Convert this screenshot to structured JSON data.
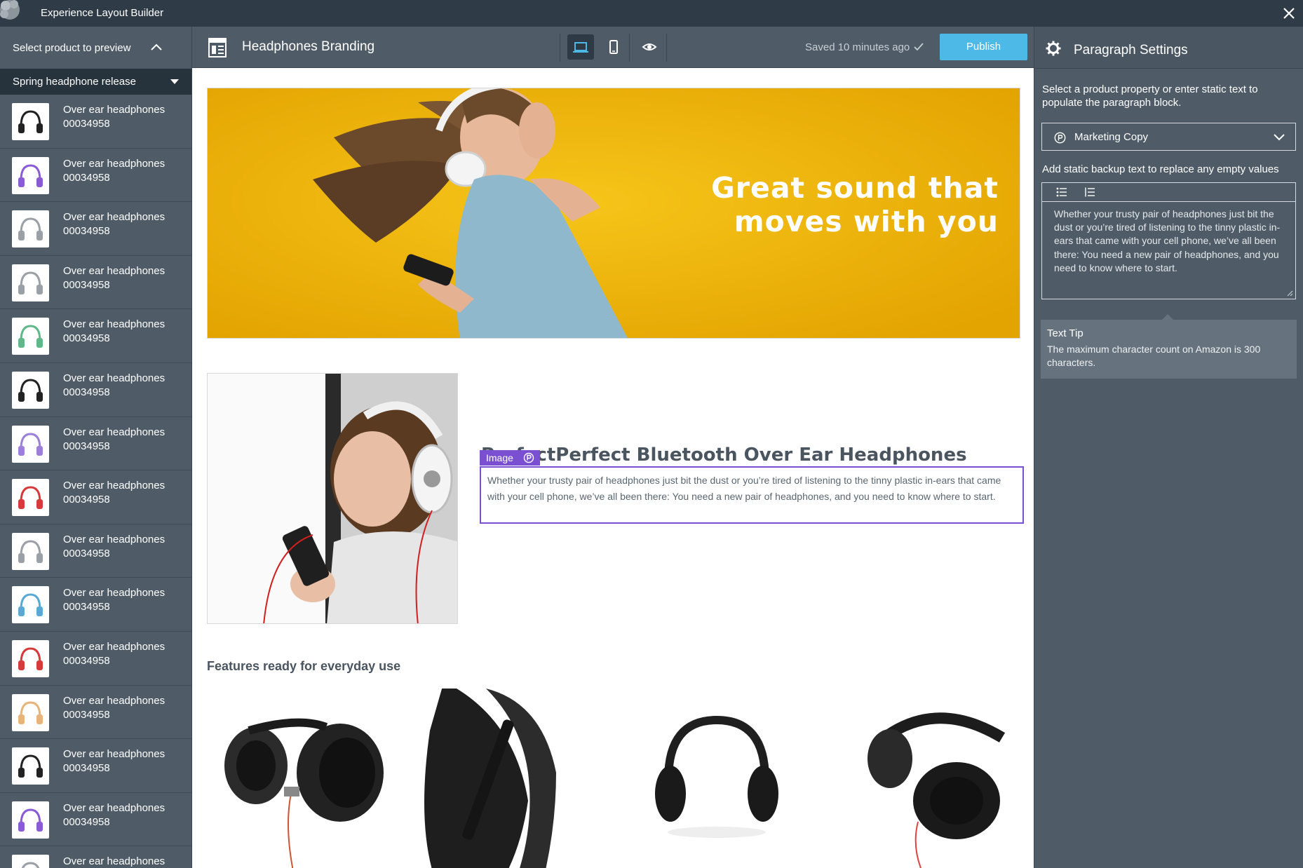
{
  "app": {
    "title": "Experience Layout Builder"
  },
  "sidebar": {
    "header": "Select product to preview",
    "campaign": "Spring headphone release",
    "products": [
      {
        "name": "Over ear headphones",
        "id": "00034958",
        "color": "#222222"
      },
      {
        "name": "Over ear headphones",
        "id": "00034958",
        "color": "#8a5bd6"
      },
      {
        "name": "Over ear headphones",
        "id": "00034958",
        "color": "#9aa0a6"
      },
      {
        "name": "Over ear headphones",
        "id": "00034958",
        "color": "#9aa0a6"
      },
      {
        "name": "Over ear headphones",
        "id": "00034958",
        "color": "#5fb88a"
      },
      {
        "name": "Over ear headphones",
        "id": "00034958",
        "color": "#222222"
      },
      {
        "name": "Over ear headphones",
        "id": "00034958",
        "color": "#9b7fd8"
      },
      {
        "name": "Over ear headphones",
        "id": "00034958",
        "color": "#d63a3a"
      },
      {
        "name": "Over ear headphones",
        "id": "00034958",
        "color": "#9aa0a6"
      },
      {
        "name": "Over ear headphones",
        "id": "00034958",
        "color": "#5aa8d6"
      },
      {
        "name": "Over ear headphones",
        "id": "00034958",
        "color": "#d63a3a"
      },
      {
        "name": "Over ear headphones",
        "id": "00034958",
        "color": "#e8b47a"
      },
      {
        "name": "Over ear headphones",
        "id": "00034958",
        "color": "#222222"
      },
      {
        "name": "Over ear headphones",
        "id": "00034958",
        "color": "#8a5bd6"
      },
      {
        "name": "Over ear headphones",
        "id": "",
        "color": "#9aa0a6"
      }
    ]
  },
  "toolbar": {
    "doc_title": "Headphones Branding",
    "saved_status": "Saved 10 minutes ago",
    "publish_label": "Publish"
  },
  "canvas": {
    "hero_headline_line1": "Great sound that",
    "hero_headline_line2": "moves with you",
    "product_title": "PerfectPerfect Bluetooth Over Ear Headphones",
    "image_tag_label": "Image",
    "paragraph": "Whether your trusty pair of headphones just bit the dust or you’re tired of listening to the tinny plastic in-ears that came with your cell phone, we’ve all been there: You need a new pair of headphones, and you need to know where to start.",
    "features_title": "Features ready for everyday use"
  },
  "settings": {
    "title": "Paragraph Settings",
    "description": "Select a product property or enter static text to populate the paragraph block.",
    "property_value": "Marketing Copy",
    "backup_label": "Add static backup text to replace any empty values",
    "backup_text": "Whether your trusty pair of headphones just bit the dust or you’re tired of listening to the tinny plastic in-ears that came with your cell phone, we’ve all been there: You need a new pair of headphones, and you need to know where to start.",
    "tip_title": "Text Tip",
    "tip_text": "The maximum character count on Amazon is 300 characters."
  },
  "colors": {
    "topbar": "#2f3c48",
    "panel": "#4f5c67",
    "campaign_bar": "#26323c",
    "accent_publish": "#4cb9e6",
    "selection_purple": "#7a4fd1",
    "hero_yellow": "#f0b400"
  }
}
